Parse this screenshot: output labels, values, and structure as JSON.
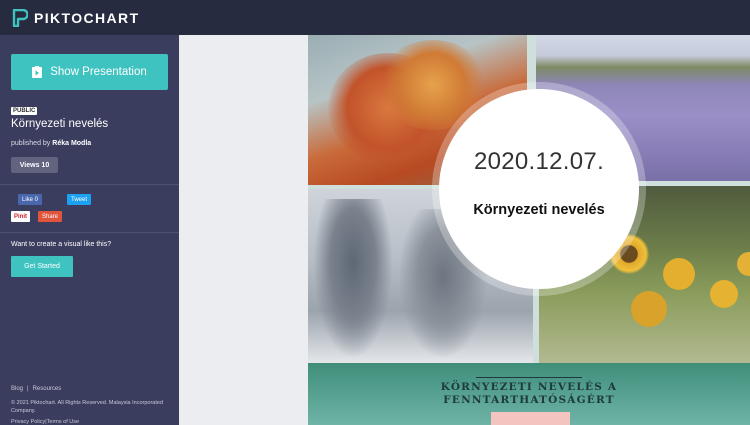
{
  "brand": {
    "name": "PIKTOCHART"
  },
  "sidebar": {
    "show_button_label": "Show Presentation",
    "public_badge": "PUBLIC",
    "title": "Környezeti nevelés",
    "published_prefix": "published by",
    "author": "Réka Modla",
    "views_label": "Views 10",
    "social": {
      "like": "Like 0",
      "tweet": "Tweet",
      "pin": "Pinit",
      "share": "Share"
    },
    "cta_text": "Want to create a visual like this?",
    "get_started": "Get Started",
    "footer": {
      "blog": "Blog",
      "resources": "Resources",
      "copyright": "© 2021 Piktochart. All Rights Reserved. Malaysia Incorporated Company.",
      "privacy": "Privacy Policy",
      "terms": "Terms of Use"
    }
  },
  "slide": {
    "date": "2020.12.07.",
    "title": "Környezeti nevelés",
    "band_title_line1": "KÖRNYEZETI NEVELÉS A",
    "band_title_line2": "FENNTARTHATÓSÁGÉRT"
  },
  "colors": {
    "topbar": "#262b3f",
    "sidebar": "#3b3d5e",
    "accent": "#3ec3c1"
  }
}
